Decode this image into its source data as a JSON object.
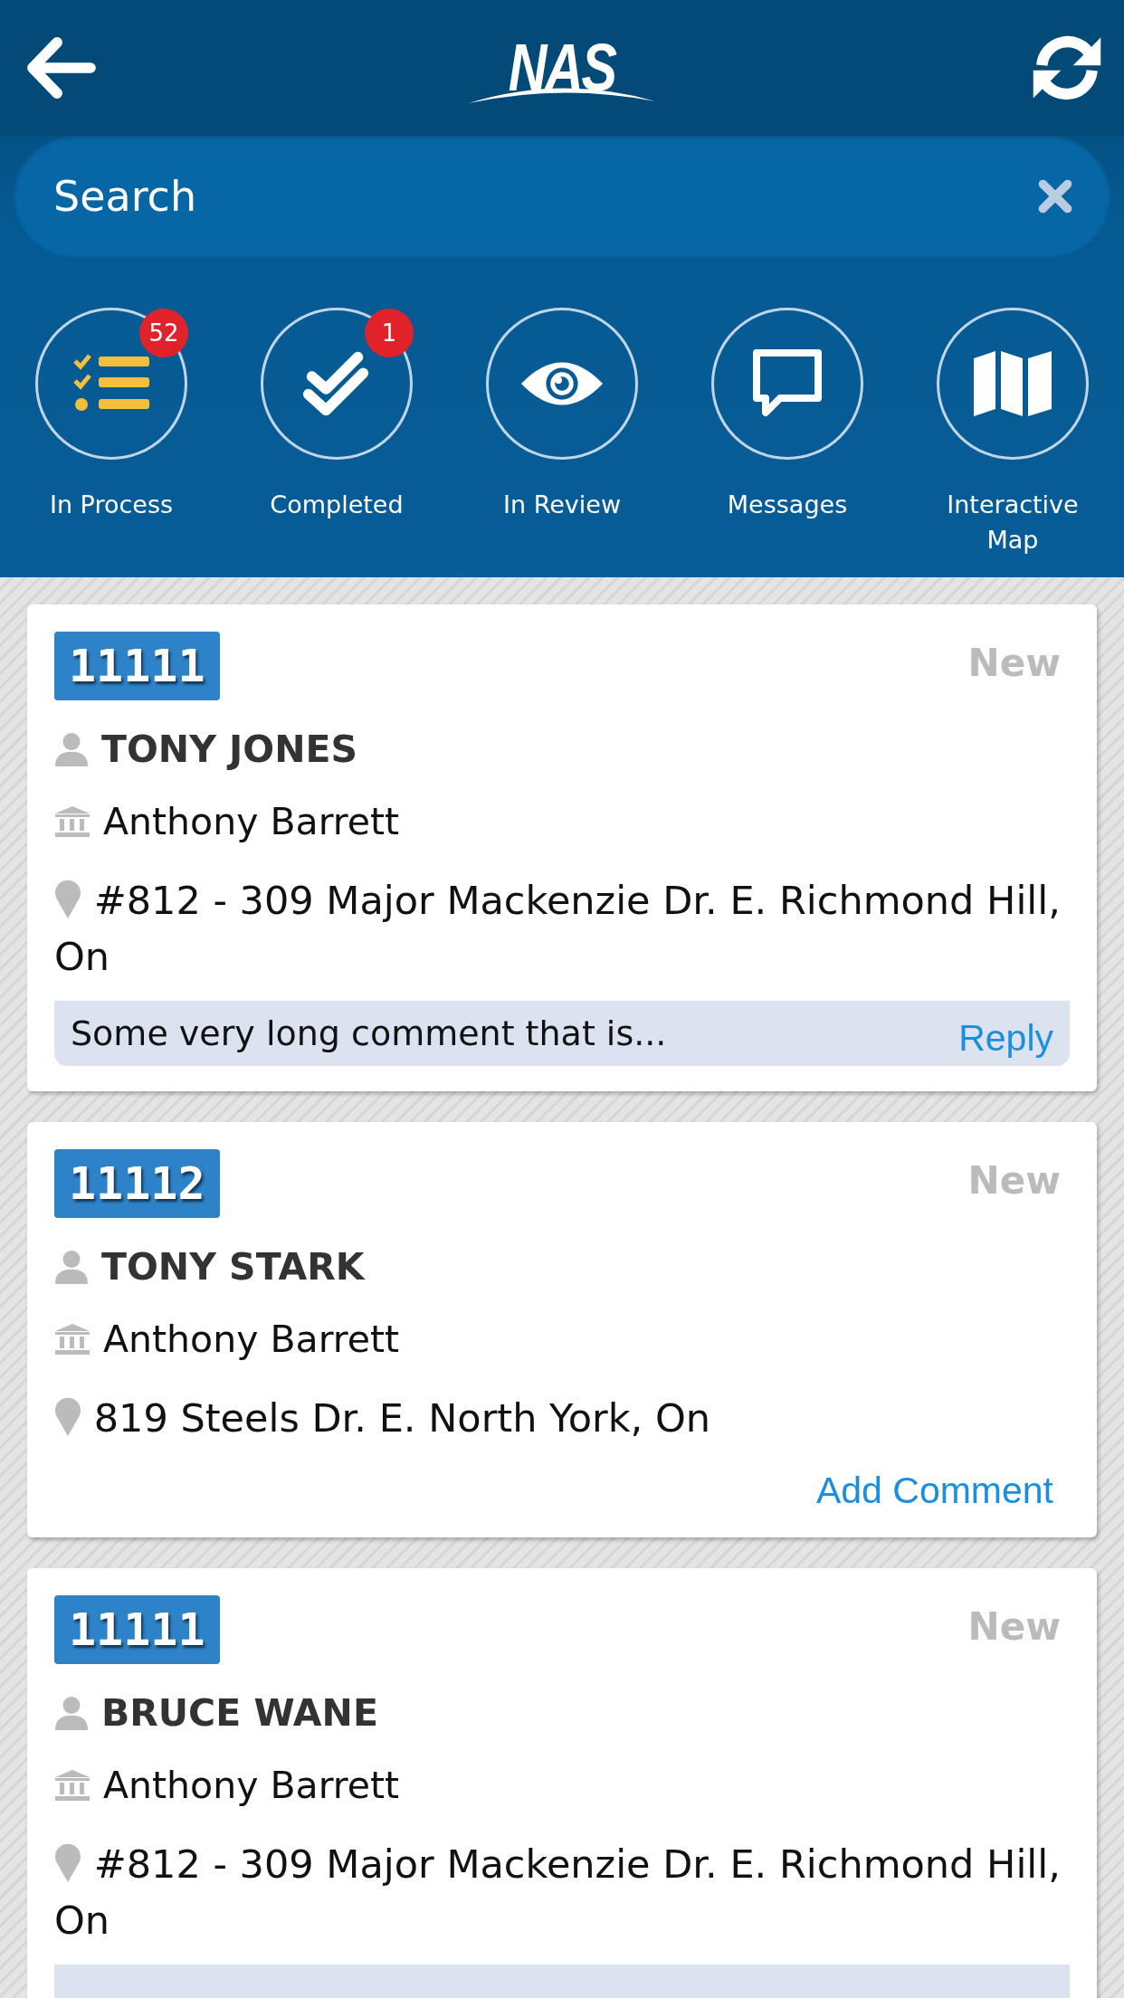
{
  "header": {
    "logo": "NAS"
  },
  "search": {
    "placeholder": "Search"
  },
  "nav": [
    {
      "kind": "process",
      "label": "In Process",
      "badge": "52"
    },
    {
      "kind": "completed",
      "label": "Completed",
      "badge": "1"
    },
    {
      "kind": "review",
      "label": "In Review"
    },
    {
      "kind": "messages",
      "label": "Messages"
    },
    {
      "kind": "map",
      "label": "Interactive Map"
    }
  ],
  "cards": [
    {
      "kind": "comment",
      "id": "11111",
      "status": "New",
      "name": "TONY JONES",
      "company": "Anthony Barrett",
      "address": "#812 - 309 Major Mackenzie Dr. E. Richmond Hill, On",
      "comment": "Some very long comment that is...",
      "action": "Reply"
    },
    {
      "kind": "add_comment",
      "id": "11112",
      "status": "New",
      "name": "TONY STARK",
      "company": "Anthony Barrett",
      "address": "819 Steels Dr. E. North York, On",
      "action": "Add Comment"
    },
    {
      "kind": "comment",
      "id": "11111",
      "status": "New",
      "name": "BRUCE WANE",
      "company": "Anthony Barrett",
      "address": "#812 - 309 Major Mackenzie Dr. E. Richmond Hill, On"
    }
  ]
}
